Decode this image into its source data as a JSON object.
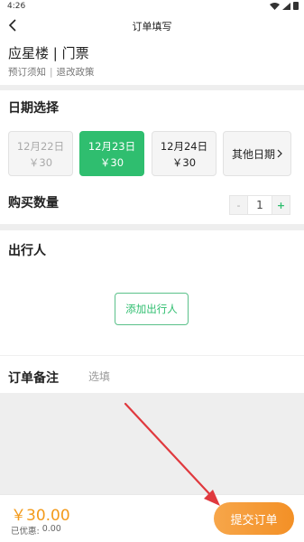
{
  "status_bar": {
    "time": "4:26"
  },
  "nav": {
    "title": "订单填写"
  },
  "header": {
    "title": "应星楼 | 门票",
    "policy_notice": "预订须知",
    "separator": "|",
    "refund_policy": "退改政策"
  },
  "date_selection": {
    "title": "日期选择",
    "dates": [
      {
        "label": "12月22日",
        "price": "￥30",
        "state": "disabled"
      },
      {
        "label": "12月23日",
        "price": "￥30",
        "state": "selected"
      },
      {
        "label": "12月24日",
        "price": "￥30",
        "state": "normal"
      }
    ],
    "other_label": "其他日期"
  },
  "quantity": {
    "title": "购买数量",
    "minus": "-",
    "value": "1",
    "plus": "+"
  },
  "traveler": {
    "title": "出行人",
    "add_button": "添加出行人"
  },
  "remark": {
    "title": "订单备注",
    "placeholder": "选填"
  },
  "bottom": {
    "total": "￥30.00",
    "discount_label": "已优惠:",
    "discount_value": "0.00",
    "submit": "提交订单"
  },
  "colors": {
    "accent_green": "#2fbe6f",
    "price_orange": "#f39a1a",
    "annotation_red": "#e0393e"
  }
}
